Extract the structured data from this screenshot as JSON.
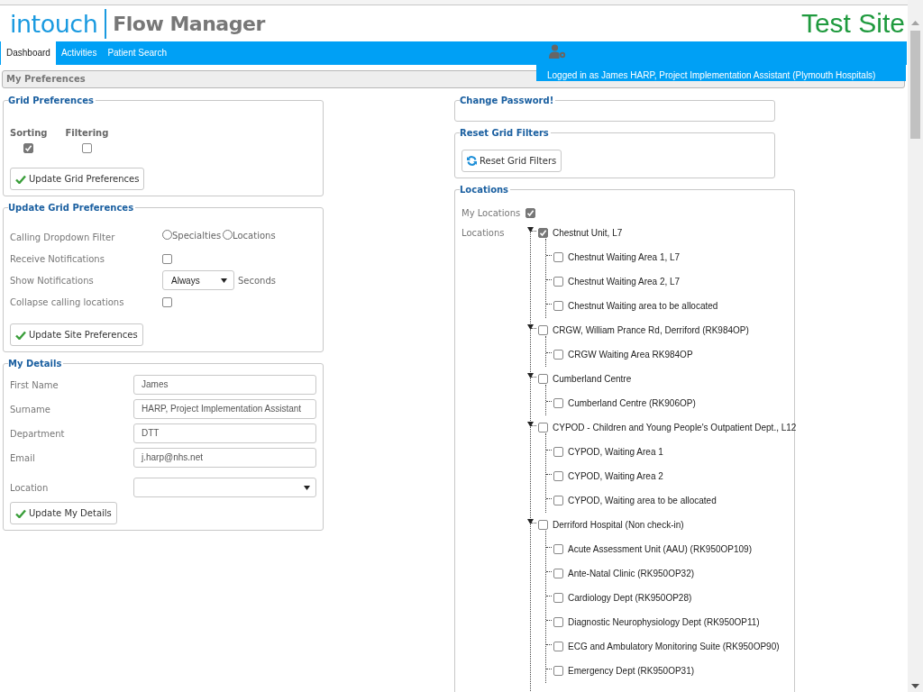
{
  "header": {
    "logo_brand": "intouch",
    "logo_product": "Flow Manager",
    "site_label": "Test Site"
  },
  "nav": {
    "tabs": [
      {
        "label": "Dashboard",
        "selected": true
      },
      {
        "label": "Activities",
        "selected": false
      },
      {
        "label": "Patient Search",
        "selected": false
      }
    ],
    "logged_in": "Logged in as James HARP, Project Implementation Assistant (Plymouth Hospitals)"
  },
  "page_title": "My Preferences",
  "grid_preferences": {
    "legend": "Grid Preferences",
    "options": [
      {
        "label": "Sorting",
        "checked": true
      },
      {
        "label": "Filtering",
        "checked": false
      }
    ],
    "button": "Update Grid Preferences"
  },
  "site_preferences": {
    "legend": "Update Grid Preferences",
    "rows": [
      {
        "kind": "radio",
        "label": "Calling Dropdown Filter",
        "options": [
          {
            "label": "Specialties",
            "selected": false
          },
          {
            "label": "Locations",
            "selected": false
          }
        ]
      },
      {
        "kind": "checkbox",
        "label": "Receive Notifications",
        "checked": false
      },
      {
        "kind": "select",
        "label": "Show Notifications",
        "value": "Always",
        "suffix": "Seconds"
      },
      {
        "kind": "checkbox",
        "label": "Collapse calling locations",
        "checked": false
      }
    ],
    "button": "Update Site Preferences"
  },
  "my_details": {
    "legend": "My Details",
    "fields": [
      {
        "kind": "text",
        "label": "First Name",
        "value": "James"
      },
      {
        "kind": "text",
        "label": "Surname",
        "value": "HARP, Project Implementation Assistant"
      },
      {
        "kind": "text",
        "label": "Department",
        "value": "DTT"
      },
      {
        "kind": "text",
        "label": "Email",
        "value": "j.harp@nhs.net"
      },
      {
        "kind": "select",
        "label": "Location"
      }
    ],
    "button": "Update My Details"
  },
  "change_password": {
    "legend": "Change Password!"
  },
  "reset_filters": {
    "legend": "Reset Grid Filters",
    "button": "Reset Grid Filters"
  },
  "locations": {
    "legend": "Locations",
    "my_locations": {
      "label": "My Locations",
      "checked": true
    },
    "tree_label": "Locations",
    "tree": [
      {
        "label": "Chestnut Unit, L7",
        "checked": true,
        "expanded": true,
        "children": [
          {
            "label": "Chestnut Waiting Area 1, L7",
            "checked": false
          },
          {
            "label": "Chestnut Waiting Area 2, L7",
            "checked": false
          },
          {
            "label": "Chestnut Waiting area to be allocated",
            "checked": false
          }
        ]
      },
      {
        "label": "CRGW, William Prance Rd, Derriford (RK984OP)",
        "checked": false,
        "expanded": true,
        "children": [
          {
            "label": "CRGW Waiting Area RK984OP",
            "checked": false
          }
        ]
      },
      {
        "label": "Cumberland Centre",
        "checked": false,
        "expanded": true,
        "children": [
          {
            "label": "Cumberland Centre (RK906OP)",
            "checked": false
          }
        ]
      },
      {
        "label": "CYPOD - Children and Young People's Outpatient Dept., L12",
        "checked": false,
        "expanded": true,
        "children": [
          {
            "label": "CYPOD, Waiting Area 1",
            "checked": false
          },
          {
            "label": "CYPOD, Waiting Area 2",
            "checked": false
          },
          {
            "label": "CYPOD, Waiting area to be allocated",
            "checked": false
          }
        ]
      },
      {
        "label": "Derriford Hospital (Non check-in)",
        "checked": false,
        "expanded": true,
        "children": [
          {
            "label": "Acute Assessment Unit (AAU) (RK950OP109)",
            "checked": false
          },
          {
            "label": "Ante-Natal Clinic (RK950OP32)",
            "checked": false
          },
          {
            "label": "Cardiology Dept (RK950OP28)",
            "checked": false
          },
          {
            "label": "Diagnostic Neurophysiology Dept (RK950OP11)",
            "checked": false
          },
          {
            "label": "ECG and Ambulatory Monitoring Suite (RK950OP90)",
            "checked": false
          },
          {
            "label": "Emergency Dept (RK950OP31)",
            "checked": false
          }
        ]
      }
    ]
  }
}
